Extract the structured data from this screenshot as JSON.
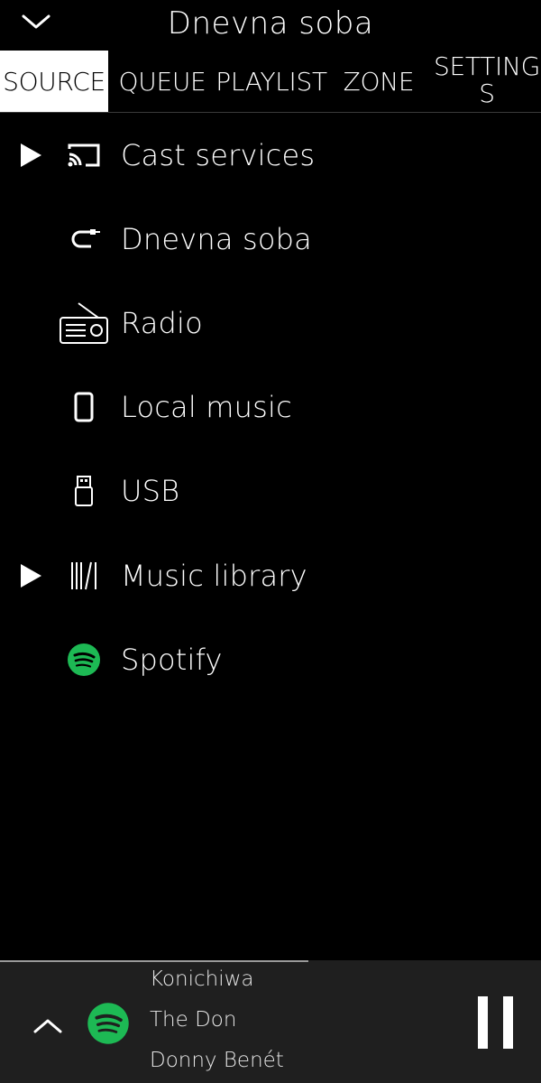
{
  "header": {
    "title": "Dnevna soba",
    "collapse_icon": "chevron-down-icon"
  },
  "tabs": [
    {
      "label": "SOURCE",
      "active": true
    },
    {
      "label": "QUEUE",
      "active": false
    },
    {
      "label": "PLAYLIST",
      "active": false
    },
    {
      "label": "ZONE",
      "active": false
    },
    {
      "label": "SETTINGS",
      "line1": "SETTING",
      "line2": "S",
      "active": false
    }
  ],
  "sources": [
    {
      "label": "Cast services",
      "icon": "cast-icon",
      "expandable": true
    },
    {
      "label": "Dnevna soba",
      "icon": "aux-cable-icon",
      "expandable": false
    },
    {
      "label": "Radio",
      "icon": "radio-icon",
      "expandable": false
    },
    {
      "label": "Local music",
      "icon": "phone-icon",
      "expandable": false
    },
    {
      "label": "USB",
      "icon": "usb-icon",
      "expandable": false
    },
    {
      "label": "Music library",
      "icon": "library-icon",
      "expandable": true
    },
    {
      "label": "Spotify",
      "icon": "spotify-icon",
      "expandable": false
    }
  ],
  "now_playing": {
    "track": "Konichiwa",
    "album": "The Don",
    "artist": "Donny Benét",
    "progress": 0.57,
    "service_icon": "spotify-icon",
    "expand_icon": "chevron-up-icon",
    "control_icon": "pause-icon"
  },
  "colors": {
    "background": "#000000",
    "player_background": "#1f1f1f",
    "spotify_green": "#1db954",
    "active_tab_background": "#ffffff"
  }
}
